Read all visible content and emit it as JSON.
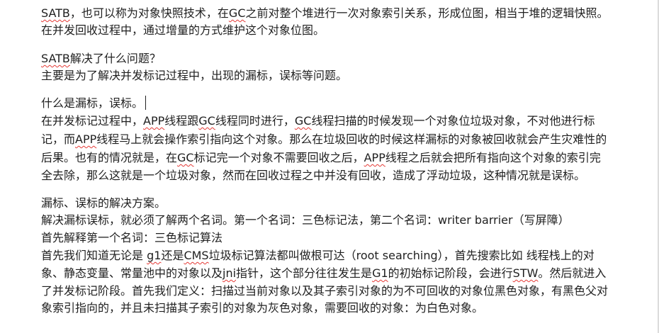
{
  "paragraphs": [
    {
      "lines": [
        [
          {
            "t": "SATB",
            "u": true
          },
          {
            "t": "，也可以称为对象快照技术，在"
          },
          {
            "t": "GC",
            "u": true
          },
          {
            "t": "之前对整个堆进行一次对象索引关系，形成位图，相当于堆的逻辑快照。"
          }
        ],
        [
          {
            "t": "在并发回收过程中，通过增量的方式维护这个对象位图。"
          }
        ]
      ]
    },
    {
      "lines": [
        [
          {
            "t": "SATB",
            "u": true
          },
          {
            "t": "解决了什么问题？"
          }
        ],
        [
          {
            "t": "主要是为了解决并发标记过程中，出现的漏标，误标等问题。"
          }
        ]
      ]
    },
    {
      "lines": [
        [
          {
            "t": "什么是漏标，误标。"
          }
        ],
        [
          {
            "t": "在并发标记过程中，"
          },
          {
            "t": "APP",
            "u": true
          },
          {
            "t": "线程跟"
          },
          {
            "t": "GC",
            "u": true
          },
          {
            "t": "线程同时进行，"
          },
          {
            "t": "GC",
            "u": true
          },
          {
            "t": "线程扫描的时候发现一个对象位垃圾对象，不对他进行标"
          }
        ],
        [
          {
            "t": "记，而"
          },
          {
            "t": "APP",
            "u": true
          },
          {
            "t": "线程马上就会操作索引指向这个对象。那么在垃圾回收的时候这样漏标的对象被回收就会产生灾难性的"
          }
        ],
        [
          {
            "t": "后果。也有的情况就是，在"
          },
          {
            "t": "GC",
            "u": true
          },
          {
            "t": "标记完一个对象不需要回收之后，"
          },
          {
            "t": "APP",
            "u": true
          },
          {
            "t": "线程之后就会把所有指向这个对象的索引完"
          }
        ],
        [
          {
            "t": "全去除，那么这就是一个垃圾对象，然而在回收过程之中并没有回收，造成了浮动垃圾，这种情况就是误标。"
          }
        ]
      ]
    },
    {
      "lines": [
        [
          {
            "t": "漏标、误标的解决方案。"
          }
        ],
        [
          {
            "t": "解决漏标误标，就必须了解两个名词。第一个名词：三色标记法，第二个名词：writer barrier（写屏障）"
          }
        ],
        [
          {
            "t": "首先解释第一个名词：三色标记算法"
          }
        ],
        [
          {
            "t": "首先我们知道无论是 "
          },
          {
            "t": "g1",
            "u": true
          },
          {
            "t": "还是"
          },
          {
            "t": "CMS",
            "u": true
          },
          {
            "t": "垃圾标记算法都叫做根可达（root searching），首先搜索比如 线程栈上的对"
          }
        ],
        [
          {
            "t": "象、静态变量、常量池中的对象以及"
          },
          {
            "t": "jni",
            "u": true
          },
          {
            "t": "指针，这个部分往往发生是"
          },
          {
            "t": "G1",
            "u": true
          },
          {
            "t": "的初始标记阶段，会进行"
          },
          {
            "t": "STW",
            "u": true
          },
          {
            "t": "。然后就进入"
          }
        ],
        [
          {
            "t": "了并发标记阶段。首先我们定义：扫描过当前对象以及其子索引对象的为不可回收的对象位黑色对象，有黑色父对"
          }
        ],
        [
          {
            "t": "象索引指向的，并且未扫描其子索引的对象为灰色对象，需要回收的对象：为白色对象。"
          }
        ]
      ]
    }
  ]
}
